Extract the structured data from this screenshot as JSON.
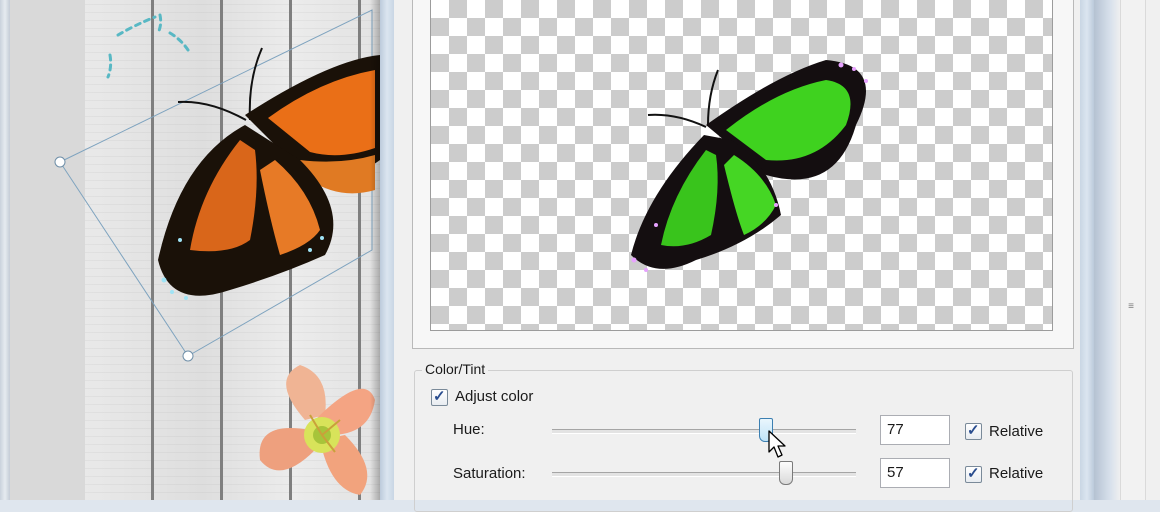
{
  "window": {
    "title_visible": false
  },
  "canvas": {
    "items": [
      {
        "kind": "monarch-butterfly",
        "color": "#d9661a"
      },
      {
        "kind": "daylily-flower",
        "color": "#f2a37d"
      }
    ]
  },
  "preview": {
    "background": "checkerboard",
    "butterfly_color": "#3fd21f"
  },
  "color_tint": {
    "legend": "Color/Tint",
    "adjust_color": {
      "label": "Adjust color",
      "checked": true
    },
    "hue": {
      "label": "Hue:",
      "value": "77",
      "relative_label": "Relative",
      "relative_checked": true
    },
    "saturation": {
      "label": "Saturation:",
      "value": "57",
      "relative_label": "Relative",
      "relative_checked": true
    }
  },
  "colors": {
    "accent": "#3c7fb1",
    "dialog_bg": "#f0f0f0"
  }
}
